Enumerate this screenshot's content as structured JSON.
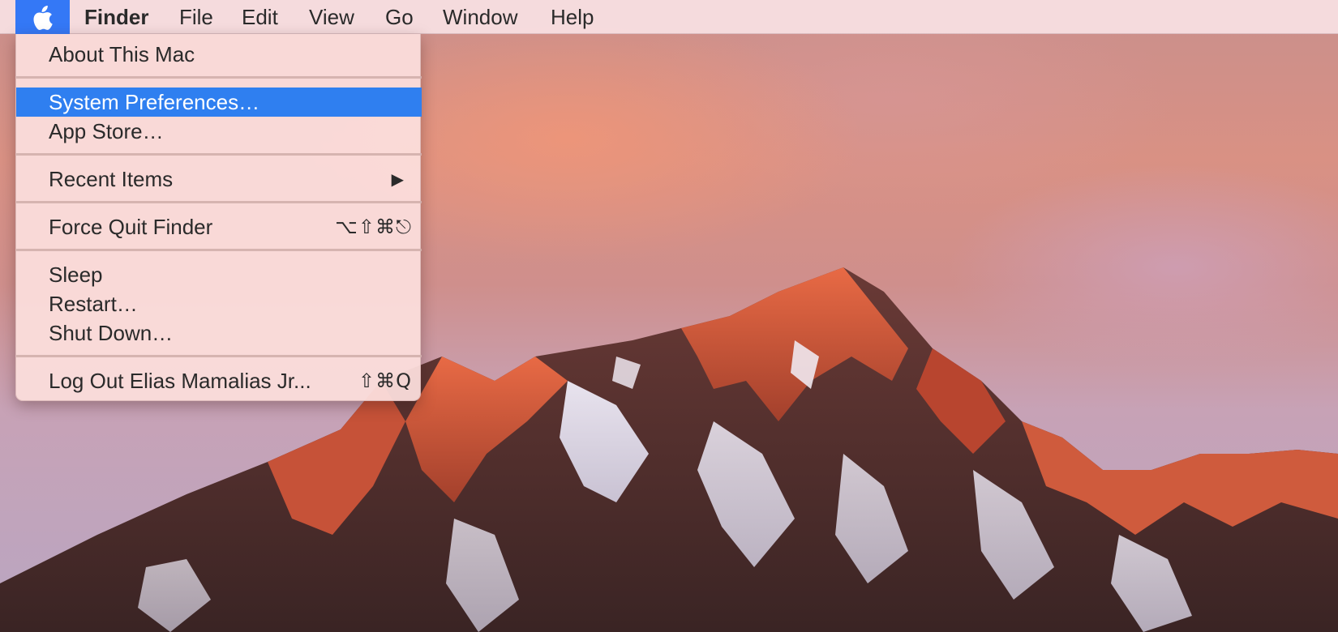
{
  "menubar": {
    "apple_icon": "apple-logo-icon",
    "app_name": "Finder",
    "menus": [
      "File",
      "Edit",
      "View",
      "Go",
      "Window",
      "Help"
    ]
  },
  "apple_menu": {
    "items": {
      "about": {
        "label": "About This Mac"
      },
      "system_preferences": {
        "label": "System Preferences…",
        "selected": true
      },
      "app_store": {
        "label": "App Store…"
      },
      "recent_items": {
        "label": "Recent Items",
        "submenu_arrow": "▶"
      },
      "force_quit": {
        "label": "Force Quit Finder",
        "shortcut": "⌥⇧⌘⎋"
      },
      "sleep": {
        "label": "Sleep"
      },
      "restart": {
        "label": "Restart…"
      },
      "shut_down": {
        "label": "Shut Down…"
      },
      "log_out": {
        "label": "Log Out Elias Mamalias Jr...",
        "shortcut": "⇧⌘Q"
      }
    },
    "highlight_color": "#2f7ff0"
  }
}
